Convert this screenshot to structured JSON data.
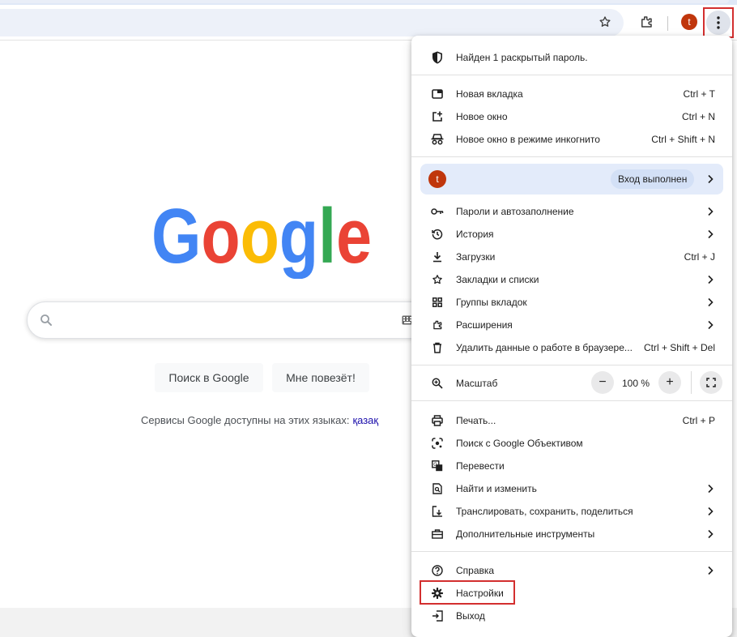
{
  "toolbar": {
    "icons": [
      "star-icon",
      "extensions-icon",
      "avatar",
      "menu-icon"
    ],
    "avatar_letter": "t"
  },
  "google": {
    "logo_text": "Google",
    "logo_letters": [
      {
        "ch": "G",
        "color": "#4285F4"
      },
      {
        "ch": "o",
        "color": "#EA4335"
      },
      {
        "ch": "o",
        "color": "#FBBC05"
      },
      {
        "ch": "g",
        "color": "#4285F4"
      },
      {
        "ch": "l",
        "color": "#34A853"
      },
      {
        "ch": "e",
        "color": "#EA4335"
      }
    ],
    "search_button": "Поиск в Google",
    "lucky_button": "Мне повезёт!",
    "languages_text": "Сервисы Google доступны на этих языках:",
    "language_link": "қазақ"
  },
  "menu": {
    "password_alert": "Найден 1 раскрытый пароль.",
    "new_tab": {
      "label": "Новая вкладка",
      "shortcut": "Ctrl + T"
    },
    "new_window": {
      "label": "Новое окно",
      "shortcut": "Ctrl + N"
    },
    "incognito": {
      "label": "Новое окно в режиме инкогнито",
      "shortcut": "Ctrl + Shift + N"
    },
    "profile": {
      "avatar_letter": "t",
      "status": "Вход выполнен"
    },
    "passwords": {
      "label": "Пароли и автозаполнение"
    },
    "history": {
      "label": "История"
    },
    "downloads": {
      "label": "Загрузки",
      "shortcut": "Ctrl + J"
    },
    "bookmarks": {
      "label": "Закладки и списки"
    },
    "tab_groups": {
      "label": "Группы вкладок"
    },
    "extensions": {
      "label": "Расширения"
    },
    "clear_data": {
      "label": "Удалить данные о работе в браузере...",
      "shortcut": "Ctrl + Shift + Del"
    },
    "zoom": {
      "label": "Масштаб",
      "minus": "−",
      "value": "100 %",
      "plus": "+"
    },
    "print": {
      "label": "Печать...",
      "shortcut": "Ctrl + P"
    },
    "lens": {
      "label": "Поиск с Google Объективом"
    },
    "translate": {
      "label": "Перевести"
    },
    "find": {
      "label": "Найти и изменить"
    },
    "cast": {
      "label": "Транслировать, сохранить, поделиться"
    },
    "more_tools": {
      "label": "Дополнительные инструменты"
    },
    "help": {
      "label": "Справка"
    },
    "settings": {
      "label": "Настройки"
    },
    "exit": {
      "label": "Выход"
    }
  },
  "colors": {
    "highlight": "#d32f2f",
    "profile_bg": "#e3ebfa",
    "avatar": "#c0360c"
  }
}
